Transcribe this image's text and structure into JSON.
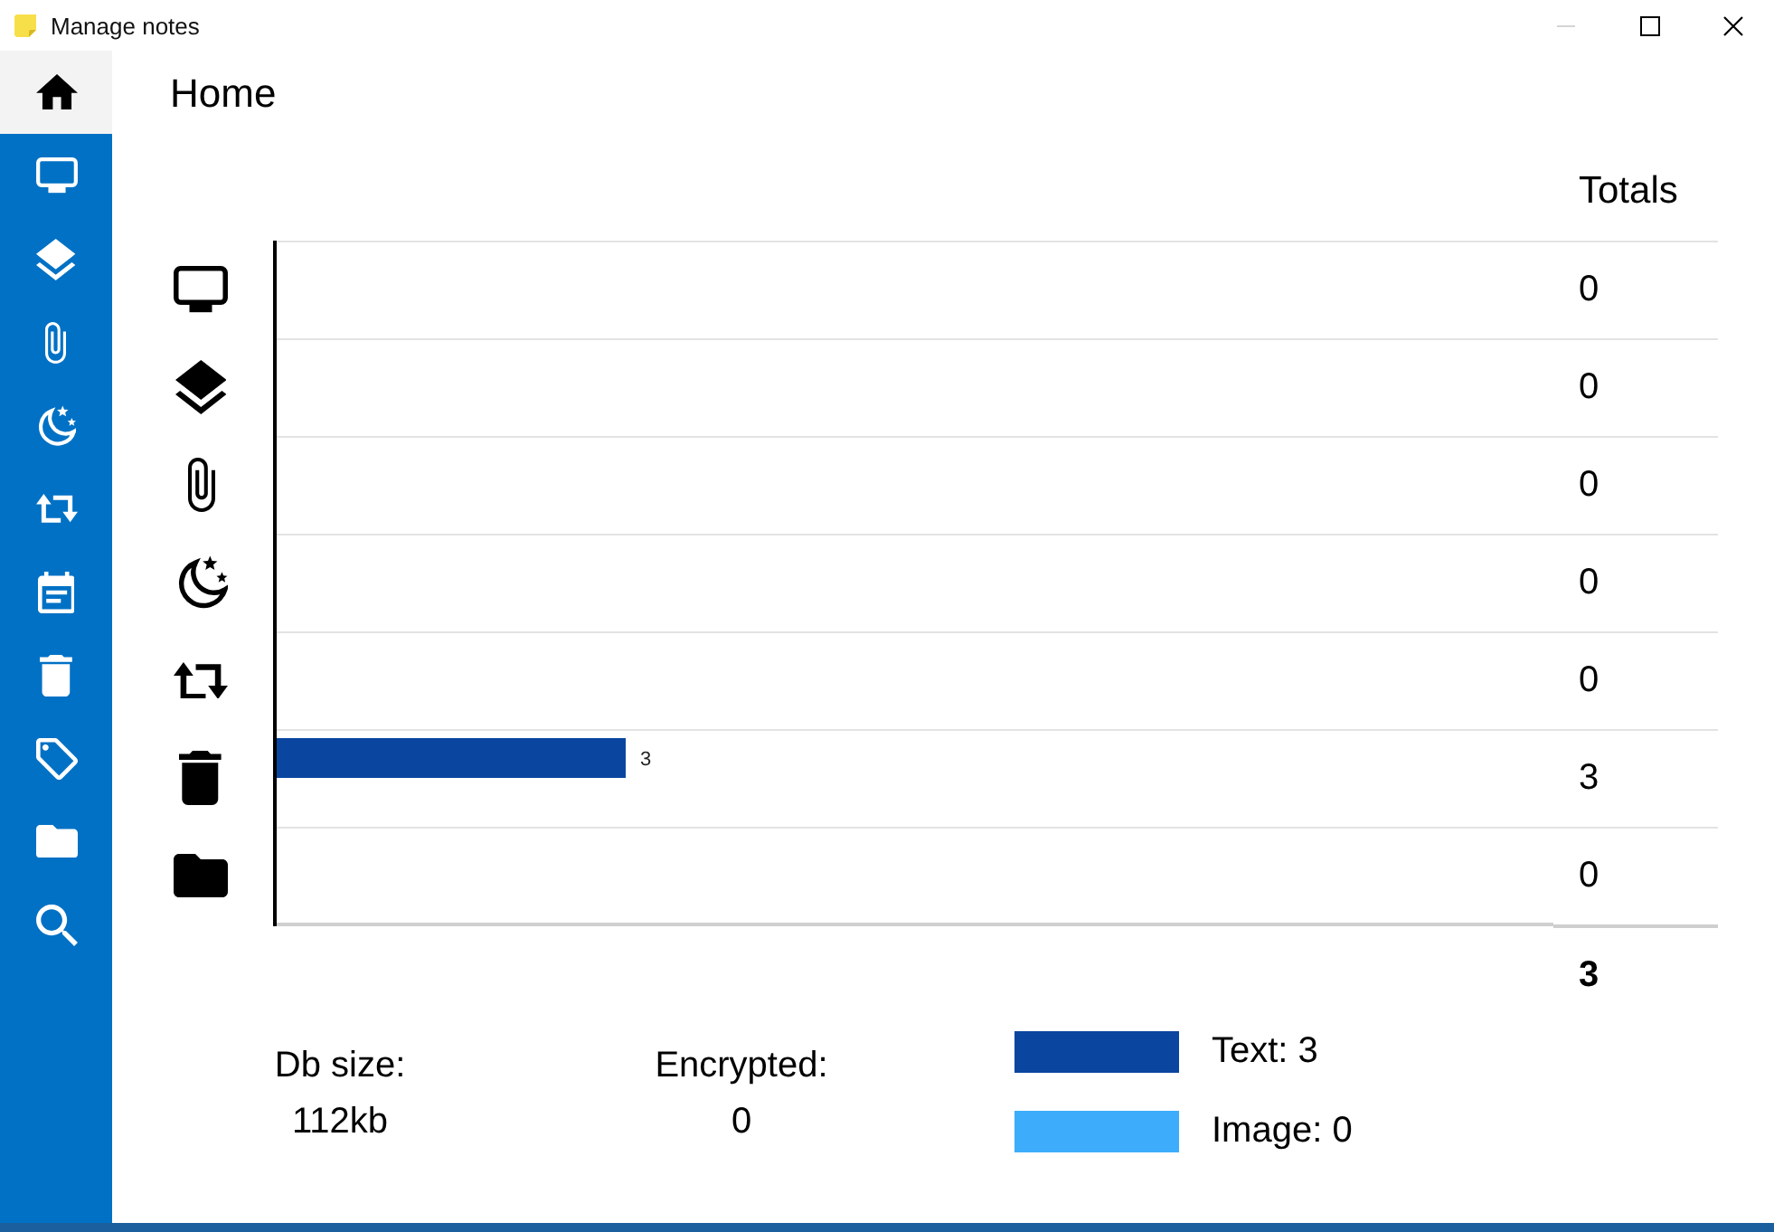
{
  "window": {
    "title": "Manage notes",
    "controls": [
      {
        "kind": "minimize",
        "disabled": true
      },
      {
        "kind": "maximize",
        "disabled": false
      },
      {
        "kind": "close",
        "disabled": false
      }
    ]
  },
  "sidebar": {
    "items": [
      {
        "kind": "home",
        "selected": true
      },
      {
        "kind": "monitor",
        "selected": false
      },
      {
        "kind": "layers",
        "selected": false
      },
      {
        "kind": "paperclip",
        "selected": false
      },
      {
        "kind": "moon",
        "selected": false
      },
      {
        "kind": "repeat",
        "selected": false
      },
      {
        "kind": "calendar",
        "selected": false
      },
      {
        "kind": "trash",
        "selected": false
      },
      {
        "kind": "tag",
        "selected": false
      },
      {
        "kind": "folder",
        "selected": false
      },
      {
        "kind": "search",
        "selected": false
      }
    ]
  },
  "page": {
    "title": "Home"
  },
  "chart": {
    "totals_header": "Totals",
    "rows": [
      {
        "kind": "monitor",
        "total": "0"
      },
      {
        "kind": "layers",
        "total": "0"
      },
      {
        "kind": "paperclip",
        "total": "0"
      },
      {
        "kind": "moon",
        "total": "0"
      },
      {
        "kind": "repeat",
        "total": "0"
      },
      {
        "kind": "trash",
        "bar": {
          "label": "3"
        },
        "total": "3"
      },
      {
        "kind": "folder",
        "total": "0"
      }
    ],
    "grand_total": "3"
  },
  "stats": [
    {
      "label": "Db size:",
      "value": "112kb"
    },
    {
      "label": "Encrypted:",
      "value": "0"
    }
  ],
  "legend": [
    {
      "label": "Text: 3",
      "color": "#0a46a0"
    },
    {
      "label": "Image: 0",
      "color": "#3dadfb"
    }
  ]
}
